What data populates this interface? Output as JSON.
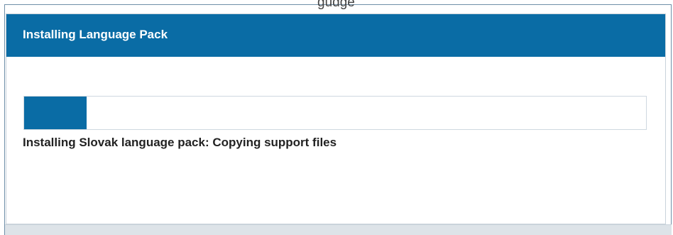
{
  "window": {
    "background_title_fragment": "ɡuɑɡe"
  },
  "dialog": {
    "title": "Installing Language Pack",
    "header_color": "#0a6ca5"
  },
  "progress": {
    "fraction": 0.1,
    "status_text": "Installing Slovak language pack: Copying support files"
  }
}
